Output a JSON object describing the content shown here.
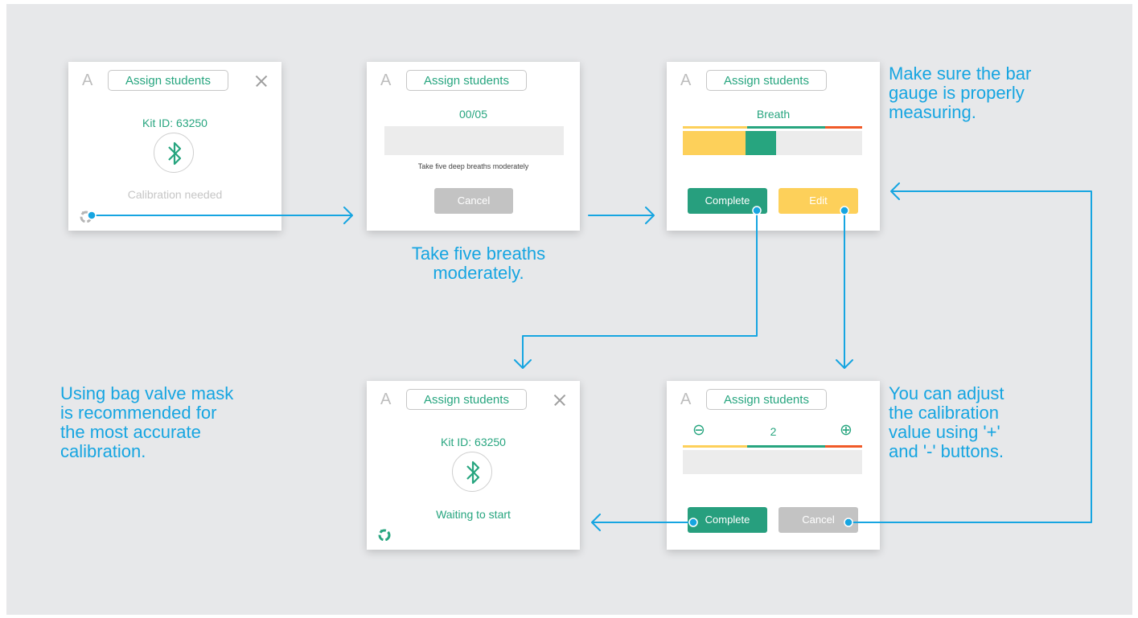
{
  "colors": {
    "background": "#e7e8ea",
    "accent": "#27a57f",
    "arrow": "#16a5e1",
    "yellow": "#fdd05a",
    "red": "#f05a28"
  },
  "cards": {
    "c1": {
      "letter": "A",
      "assign": "Assign students",
      "kit": "Kit ID: 63250",
      "status": "Calibration needed"
    },
    "c2": {
      "letter": "A",
      "assign": "Assign students",
      "count": "00/05",
      "instruction": "Take five  deep breaths moderately",
      "cancel": "Cancel"
    },
    "c3": {
      "letter": "A",
      "assign": "Assign students",
      "label": "Breath",
      "complete": "Complete",
      "edit": "Edit"
    },
    "c4": {
      "letter": "A",
      "assign": "Assign students",
      "kit": "Kit ID: 63250",
      "status": "Waiting to start"
    },
    "c5": {
      "letter": "A",
      "assign": "Assign students",
      "value": "2",
      "minus": "⊖",
      "plus": "⊕",
      "complete": "Complete",
      "cancel": "Cancel"
    }
  },
  "notes": {
    "breaths": [
      "Take five breaths",
      "moderately."
    ],
    "gauge": [
      "Make sure the bar",
      "gauge is properly",
      "measuring."
    ],
    "adjust": [
      "You can adjust",
      "the calibration",
      "value using '+'",
      "and '-' buttons."
    ],
    "mask": [
      "Using bag valve mask",
      "is recommended for",
      "the most accurate",
      "calibration."
    ]
  }
}
